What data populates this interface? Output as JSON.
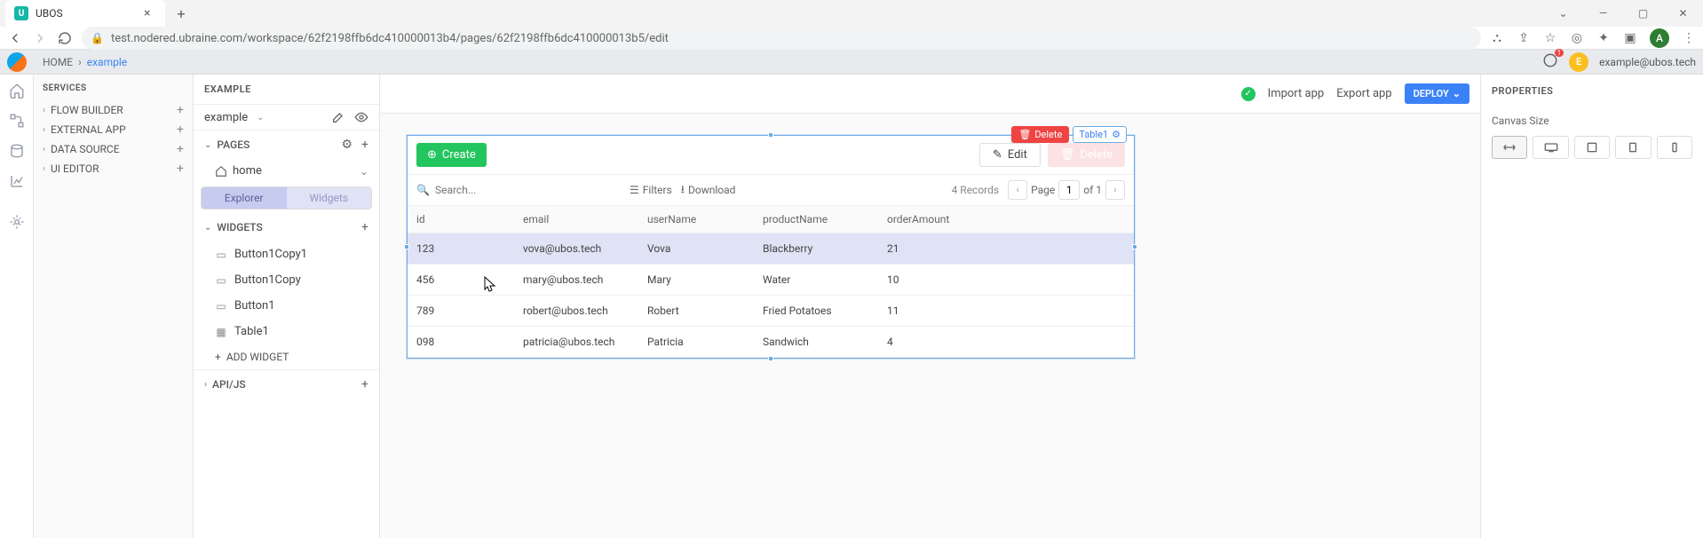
{
  "browser": {
    "tab_title": "UBOS",
    "tab_favicon_letter": "U",
    "url": "test.nodered.ubraine.com/workspace/62f2198ffb6dc410000013b4/pages/62f2198ffb6dc410000013b5/edit",
    "profile_letter": "A"
  },
  "topbar": {
    "home": "HOME",
    "crumb_sep": "›",
    "crumb_page": "example",
    "notif_count": "1",
    "user_letter": "E",
    "user_email": "example@ubos.tech"
  },
  "services": {
    "title": "SERVICES",
    "items": [
      "FLOW BUILDER",
      "EXTERNAL APP",
      "DATA SOURCE",
      "UI EDITOR"
    ]
  },
  "explorer": {
    "header": "EXAMPLE",
    "project": "example",
    "pages_label": "PAGES",
    "page_home": "home",
    "tab_explorer": "Explorer",
    "tab_widgets": "Widgets",
    "widgets_label": "WIDGETS",
    "widget_items": [
      "Button1Copy1",
      "Button1Copy",
      "Button1",
      "Table1"
    ],
    "add_widget": "ADD WIDGET",
    "api_label": "API/JS"
  },
  "canvas_header": {
    "import": "Import app",
    "export": "Export app",
    "deploy": "DEPLOY"
  },
  "widget": {
    "badge_delete": "Delete",
    "badge_name": "Table1",
    "create": "Create",
    "edit": "Edit",
    "delete": "Delete",
    "search_placeholder": "Search...",
    "filters": "Filters",
    "download": "Download",
    "records": "4 Records",
    "page_label": "Page",
    "page_value": "1",
    "page_of": "of 1"
  },
  "table": {
    "columns": [
      "id",
      "email",
      "userName",
      "productName",
      "orderAmount"
    ],
    "rows": [
      {
        "id": "123",
        "email": "vova@ubos.tech",
        "userName": "Vova",
        "productName": "Blackberry",
        "orderAmount": "21"
      },
      {
        "id": "456",
        "email": "mary@ubos.tech",
        "userName": "Mary",
        "productName": "Water",
        "orderAmount": "10"
      },
      {
        "id": "789",
        "email": "robert@ubos.tech",
        "userName": "Robert",
        "productName": "Fried Potatoes",
        "orderAmount": "11"
      },
      {
        "id": "098",
        "email": "patricia@ubos.tech",
        "userName": "Patricia",
        "productName": "Sandwich",
        "orderAmount": "4"
      }
    ]
  },
  "props": {
    "title": "PROPERTIES",
    "canvas_size": "Canvas Size"
  }
}
